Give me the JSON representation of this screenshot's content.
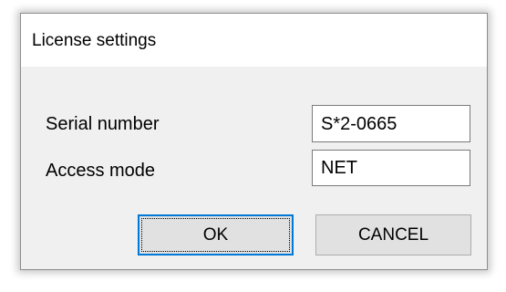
{
  "dialog": {
    "title": "License settings",
    "serial_label": "Serial number",
    "serial_value": "S*2-0665",
    "access_label": "Access mode",
    "access_value": "NET",
    "ok_label": "OK",
    "cancel_label": "CANCEL"
  },
  "colors": {
    "dialog_background": "#f0f0f0",
    "focus_border": "#0078d7",
    "button_face": "#e1e1e1"
  }
}
